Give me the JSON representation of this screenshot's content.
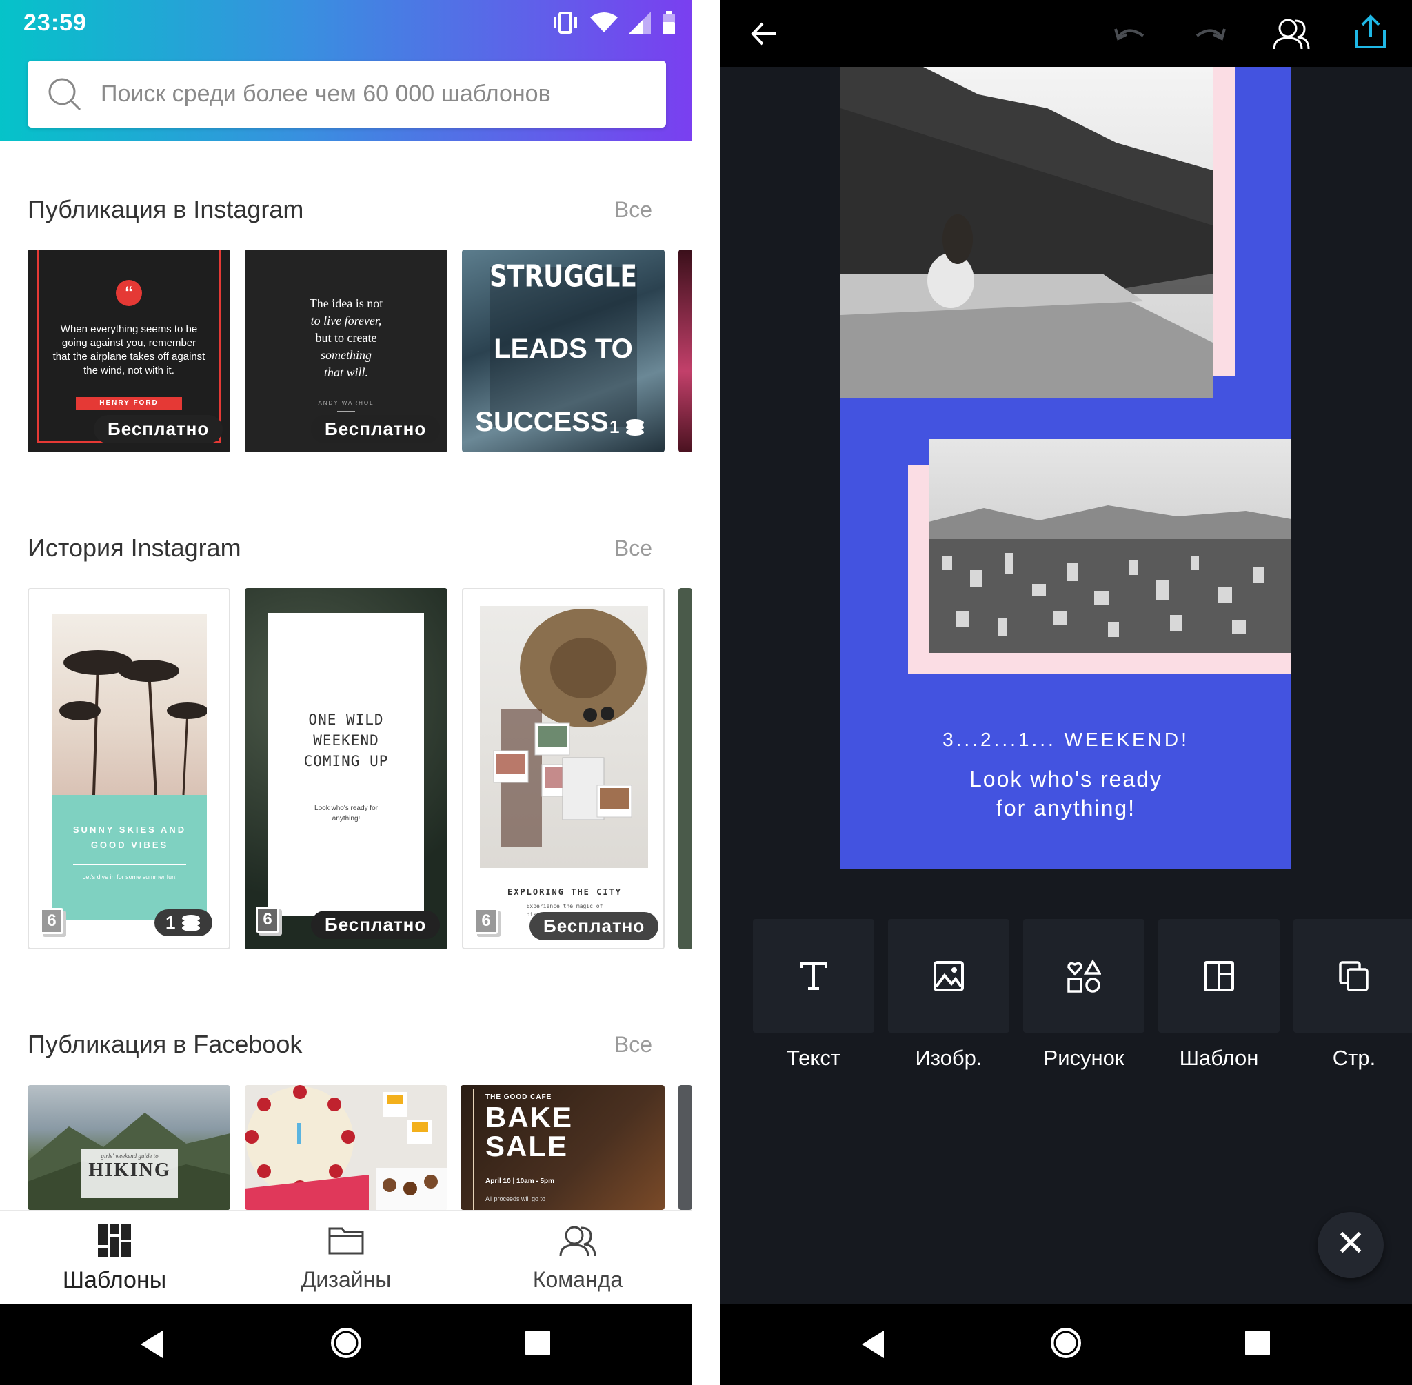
{
  "left_screen": {
    "status": {
      "time": "23:59"
    },
    "search": {
      "placeholder": "Поиск среди более чем 60 000 шаблонов"
    },
    "sections": [
      {
        "title": "Публикация в Instagram",
        "all_label": "Все",
        "cards": [
          {
            "quote": "When everything seems to be going against you, remember that the airplane takes off against the wind, not with it.",
            "author": "HENRY FORD",
            "badge": "Бесплатно"
          },
          {
            "quote_lines": [
              "The idea is not",
              "to live forever,",
              "but to create",
              "something",
              "that will."
            ],
            "author": "ANDY WARHOL",
            "badge": "Бесплатно"
          },
          {
            "lines": [
              "STRUGGLE",
              "LEADS TO",
              "SUCCESS"
            ],
            "price": "1"
          }
        ]
      },
      {
        "title": "История Instagram",
        "all_label": "Все",
        "cards": [
          {
            "title": "SUNNY SKIES AND GOOD VIBES",
            "subtitle": "Let's dive in for some summer fun!",
            "pages": "6",
            "price": "1"
          },
          {
            "title_lines": [
              "ONE WILD",
              "WEEKEND",
              "COMING UP"
            ],
            "subtitle": "Look who's ready for anything!",
            "pages": "6",
            "badge": "Бесплатно"
          },
          {
            "title": "EXPLORING THE CITY",
            "subtitle": "Experience the magic of discovering a new place",
            "pages": "6",
            "badge": "Бесплатно"
          }
        ]
      },
      {
        "title": "Публикация в Facebook",
        "all_label": "Все",
        "cards": [
          {
            "small": "girls' weekend guide to",
            "title": "HIKING"
          },
          {},
          {
            "small": "THE GOOD CAFE",
            "title_lines": [
              "BAKE",
              "SALE"
            ],
            "date": "April 10 | 10am - 5pm",
            "note": "All proceeds will go to"
          }
        ]
      }
    ],
    "bottom_nav": [
      {
        "label": "Шаблоны",
        "icon": "templates-grid-icon",
        "active": true
      },
      {
        "label": "Дизайны",
        "icon": "folder-icon",
        "active": false
      },
      {
        "label": "Команда",
        "icon": "team-icon",
        "active": false
      }
    ]
  },
  "right_screen": {
    "design": {
      "line1": "3...2...1... WEEKEND!",
      "line2a": "Look who's ready",
      "line2b": "for anything!",
      "bg_color": "#4353e0",
      "accent_pink": "#fbdde4"
    },
    "tools": [
      {
        "label": "Текст",
        "icon": "text-icon"
      },
      {
        "label": "Изобр.",
        "icon": "image-icon"
      },
      {
        "label": "Рисунок",
        "icon": "shapes-icon"
      },
      {
        "label": "Шаблон",
        "icon": "layout-icon"
      },
      {
        "label": "Стр.",
        "icon": "pages-icon"
      }
    ],
    "close_symbol": "✕"
  },
  "colors": {
    "share_accent": "#1fb8e6",
    "header_start": "#05c3c9",
    "header_end": "#7a3ff0",
    "dark_bg": "#16191f"
  }
}
